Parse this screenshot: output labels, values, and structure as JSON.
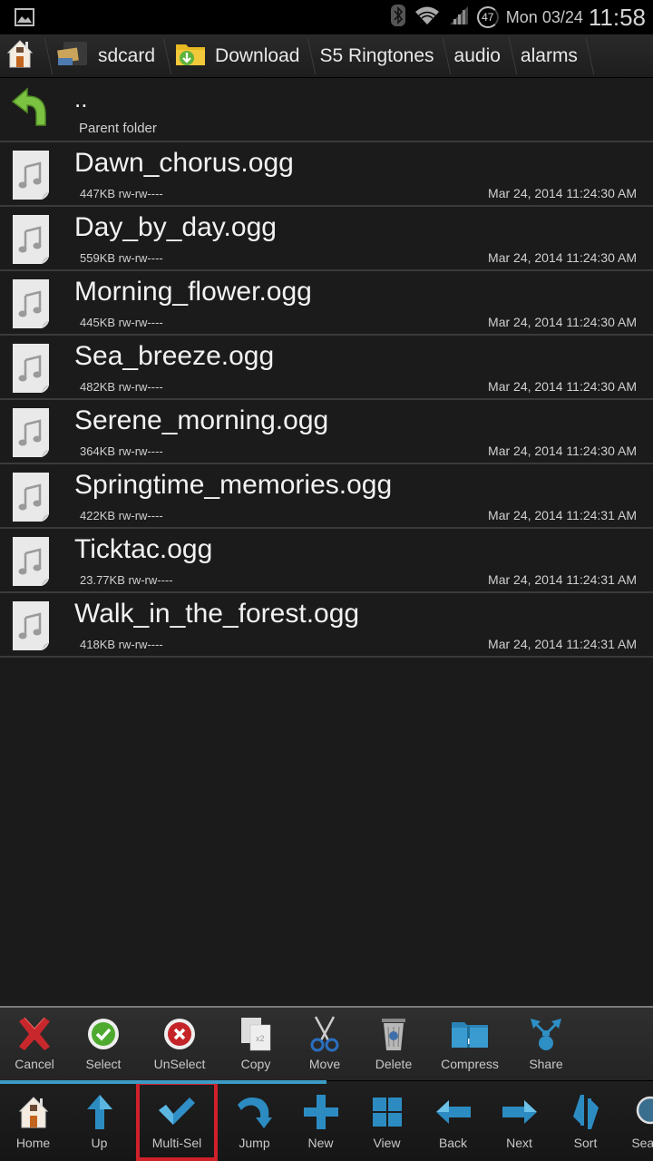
{
  "status_bar": {
    "notification_icon": "image-icon",
    "bluetooth_icon": "bluetooth-icon",
    "wifi_icon": "wifi-icon",
    "signal_icon": "signal-icon",
    "battery_level": "47",
    "date": "Mon 03/24",
    "time": "11:58"
  },
  "breadcrumb": [
    {
      "label": "",
      "icon": "home-icon"
    },
    {
      "label": "sdcard",
      "icon": "sdcard-folder-icon"
    },
    {
      "label": "Download",
      "icon": "download-folder-icon"
    },
    {
      "label": "S5 Ringtones",
      "icon": ""
    },
    {
      "label": "audio",
      "icon": ""
    },
    {
      "label": "alarms",
      "icon": ""
    }
  ],
  "parent_folder": {
    "name": "..",
    "label": "Parent folder",
    "icon": "parent-folder-arrow-icon"
  },
  "files": [
    {
      "name": "Dawn_chorus.ogg",
      "size": "447KB",
      "perms": "rw-rw----",
      "date": "Mar 24, 2014 11:24:30 AM"
    },
    {
      "name": "Day_by_day.ogg",
      "size": "559KB",
      "perms": "rw-rw----",
      "date": "Mar 24, 2014 11:24:30 AM"
    },
    {
      "name": "Morning_flower.ogg",
      "size": "445KB",
      "perms": "rw-rw----",
      "date": "Mar 24, 2014 11:24:30 AM"
    },
    {
      "name": "Sea_breeze.ogg",
      "size": "482KB",
      "perms": "rw-rw----",
      "date": "Mar 24, 2014 11:24:30 AM"
    },
    {
      "name": "Serene_morning.ogg",
      "size": "364KB",
      "perms": "rw-rw----",
      "date": "Mar 24, 2014 11:24:30 AM"
    },
    {
      "name": "Springtime_memories.ogg",
      "size": "422KB",
      "perms": "rw-rw----",
      "date": "Mar 24, 2014 11:24:31 AM"
    },
    {
      "name": "Ticktac.ogg",
      "size": "23.77KB",
      "perms": "rw-rw----",
      "date": "Mar 24, 2014 11:24:31 AM"
    },
    {
      "name": "Walk_in_the_forest.ogg",
      "size": "418KB",
      "perms": "rw-rw----",
      "date": "Mar 24, 2014 11:24:31 AM"
    }
  ],
  "action_bar": [
    {
      "label": "Cancel",
      "icon": "cancel-x-icon"
    },
    {
      "label": "Select",
      "icon": "select-check-icon"
    },
    {
      "label": "UnSelect",
      "icon": "unselect-x-icon"
    },
    {
      "label": "Copy",
      "icon": "copy-icon"
    },
    {
      "label": "Move",
      "icon": "scissors-icon"
    },
    {
      "label": "Delete",
      "icon": "trash-icon"
    },
    {
      "label": "Compress",
      "icon": "zip-folder-icon"
    },
    {
      "label": "Share",
      "icon": "share-icon"
    }
  ],
  "bottom_bar": [
    {
      "label": "Home",
      "icon": "home-icon"
    },
    {
      "label": "Up",
      "icon": "up-arrow-icon"
    },
    {
      "label": "Multi-Sel",
      "icon": "checkmark-icon",
      "highlighted": true
    },
    {
      "label": "Jump",
      "icon": "jump-arrow-icon"
    },
    {
      "label": "New",
      "icon": "plus-icon"
    },
    {
      "label": "View",
      "icon": "grid-view-icon"
    },
    {
      "label": "Back",
      "icon": "left-arrow-icon"
    },
    {
      "label": "Next",
      "icon": "right-arrow-icon"
    },
    {
      "label": "Sort",
      "icon": "sort-icon"
    },
    {
      "label": "Search",
      "icon": "search-icon"
    }
  ],
  "colors": {
    "accent_blue": "#3a9bc5",
    "highlight_red": "#d0202a",
    "background": "#1b1b1b"
  }
}
